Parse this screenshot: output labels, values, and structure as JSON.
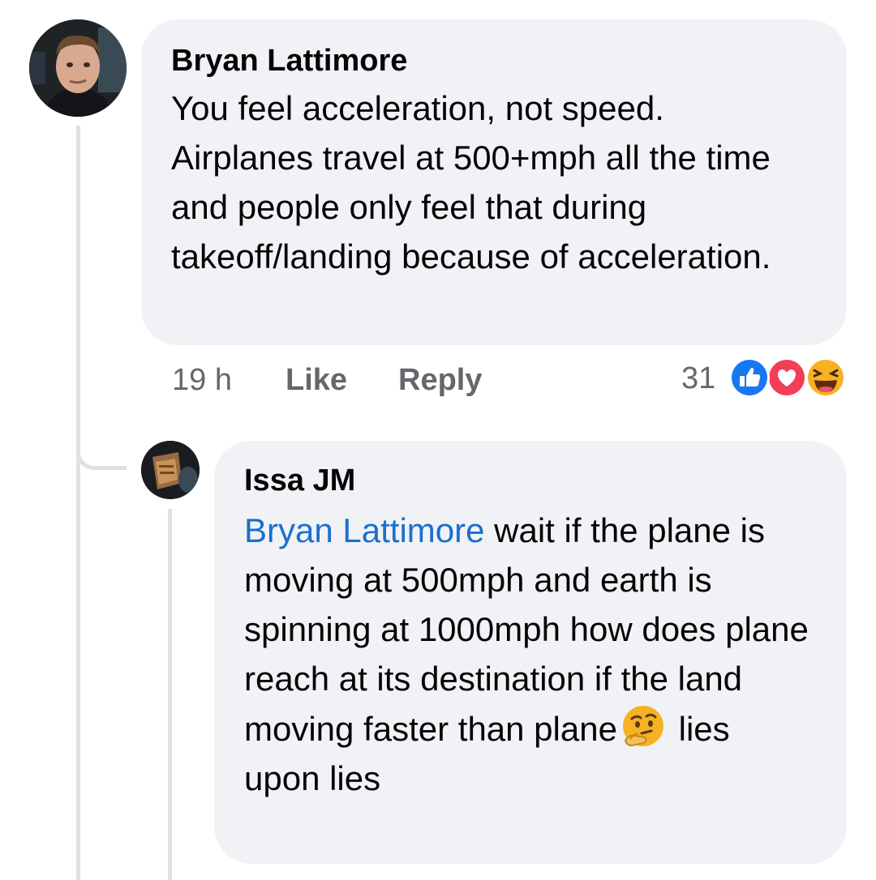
{
  "comment": {
    "author": "Bryan Lattimore",
    "text": "You feel acceleration, not speed. Airplanes travel at 500+mph all the time and people only feel that during takeoff/landing because of acceleration.",
    "time": "19 h",
    "like_label": "Like",
    "reply_label": "Reply",
    "reaction_count": "31",
    "reactions": [
      "like-icon",
      "love-icon",
      "haha-icon"
    ]
  },
  "reply": {
    "author": "Issa JM",
    "mention": "Bryan Lattimore",
    "text_part1": " wait if the plane is moving at 500mph and earth is spinning at 1000mph how does plane reach at its destination if the land moving faster than plane",
    "emoji": "thinking-face-icon",
    "text_part2": " lies upon lies"
  },
  "colors": {
    "bubble": "#f0f2f5",
    "mention": "#1b6fcf",
    "meta": "#65676b",
    "like": "#1877f2",
    "love": "#f33e58",
    "haha": "#f7b125"
  }
}
